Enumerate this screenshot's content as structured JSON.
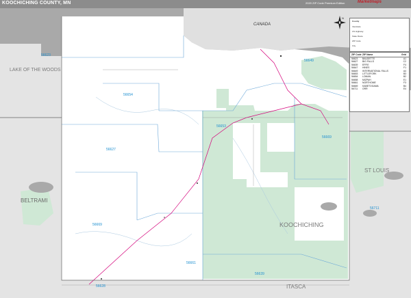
{
  "header": {
    "title": "KOOCHICHING COUNTY, MN",
    "edition": "2020 ZIP Code Premium Edition",
    "brand": "Marketmaps"
  },
  "colors": {
    "water": "#a9a9a9",
    "land": "#ffffff",
    "outside_county": "#e4e4e4",
    "public_land": "#cfe8d5",
    "zip_boundary": "#6aa7d8",
    "road": "#d4007a",
    "zip_label": "#1e8fd0"
  },
  "map": {
    "country_label": "CANADA",
    "county_label": "KOOCHICHING",
    "neighbor_counties": [
      "LAKE OF THE WOODS",
      "BELTRAMI",
      "ST LOUIS",
      "ITASCA"
    ],
    "zip_labels": [
      "56623",
      "56649",
      "56654",
      "56627",
      "56653",
      "56669",
      "56669",
      "56661",
      "56639",
      "56711",
      "56628"
    ],
    "north_letter": "N"
  },
  "legend": {
    "title": "County",
    "items": [
      "Interstate",
      "US Highway",
      "State Route",
      "ZIP Code",
      "City"
    ]
  },
  "zip_table": {
    "headers": [
      "ZIP Code",
      "ZIP Name",
      "Grid"
    ],
    "rows": [
      [
        "56623",
        "BAUDETTE",
        "A1"
      ],
      [
        "56627",
        "BIG FALLS",
        "C2"
      ],
      [
        "56639",
        "EFFIE",
        "F4"
      ],
      [
        "56647",
        "HINES",
        "F1"
      ],
      [
        "56649",
        "INTERNATIONAL FALLS",
        "A4"
      ],
      [
        "56653",
        "LITTLEFORK",
        "B3"
      ],
      [
        "56654",
        "LOMAN",
        "B2"
      ],
      [
        "56658",
        "MIZPAH",
        "E1"
      ],
      [
        "56661",
        "NORTHOME",
        "F3"
      ],
      [
        "56669",
        "KABETOGAMA",
        "B4"
      ],
      [
        "56711",
        "ORR",
        "E4"
      ]
    ]
  }
}
